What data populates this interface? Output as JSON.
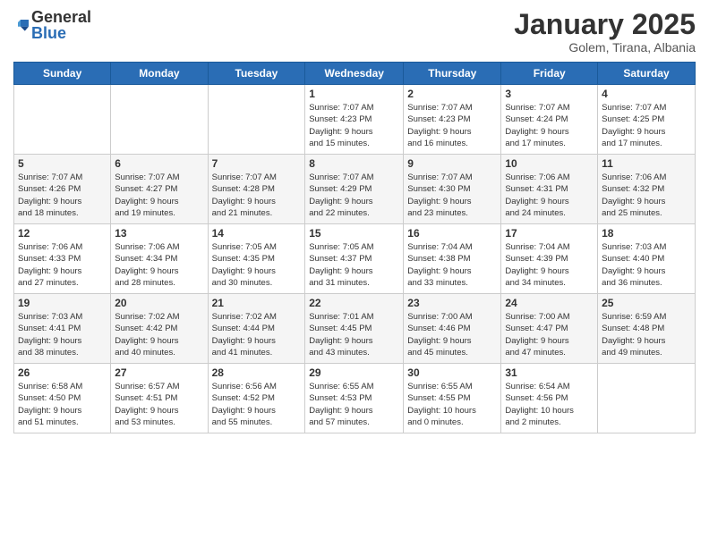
{
  "logo": {
    "general": "General",
    "blue": "Blue"
  },
  "title": "January 2025",
  "location": "Golem, Tirana, Albania",
  "weekdays": [
    "Sunday",
    "Monday",
    "Tuesday",
    "Wednesday",
    "Thursday",
    "Friday",
    "Saturday"
  ],
  "weeks": [
    [
      {
        "day": "",
        "info": ""
      },
      {
        "day": "",
        "info": ""
      },
      {
        "day": "",
        "info": ""
      },
      {
        "day": "1",
        "info": "Sunrise: 7:07 AM\nSunset: 4:23 PM\nDaylight: 9 hours\nand 15 minutes."
      },
      {
        "day": "2",
        "info": "Sunrise: 7:07 AM\nSunset: 4:23 PM\nDaylight: 9 hours\nand 16 minutes."
      },
      {
        "day": "3",
        "info": "Sunrise: 7:07 AM\nSunset: 4:24 PM\nDaylight: 9 hours\nand 17 minutes."
      },
      {
        "day": "4",
        "info": "Sunrise: 7:07 AM\nSunset: 4:25 PM\nDaylight: 9 hours\nand 17 minutes."
      }
    ],
    [
      {
        "day": "5",
        "info": "Sunrise: 7:07 AM\nSunset: 4:26 PM\nDaylight: 9 hours\nand 18 minutes."
      },
      {
        "day": "6",
        "info": "Sunrise: 7:07 AM\nSunset: 4:27 PM\nDaylight: 9 hours\nand 19 minutes."
      },
      {
        "day": "7",
        "info": "Sunrise: 7:07 AM\nSunset: 4:28 PM\nDaylight: 9 hours\nand 21 minutes."
      },
      {
        "day": "8",
        "info": "Sunrise: 7:07 AM\nSunset: 4:29 PM\nDaylight: 9 hours\nand 22 minutes."
      },
      {
        "day": "9",
        "info": "Sunrise: 7:07 AM\nSunset: 4:30 PM\nDaylight: 9 hours\nand 23 minutes."
      },
      {
        "day": "10",
        "info": "Sunrise: 7:06 AM\nSunset: 4:31 PM\nDaylight: 9 hours\nand 24 minutes."
      },
      {
        "day": "11",
        "info": "Sunrise: 7:06 AM\nSunset: 4:32 PM\nDaylight: 9 hours\nand 25 minutes."
      }
    ],
    [
      {
        "day": "12",
        "info": "Sunrise: 7:06 AM\nSunset: 4:33 PM\nDaylight: 9 hours\nand 27 minutes."
      },
      {
        "day": "13",
        "info": "Sunrise: 7:06 AM\nSunset: 4:34 PM\nDaylight: 9 hours\nand 28 minutes."
      },
      {
        "day": "14",
        "info": "Sunrise: 7:05 AM\nSunset: 4:35 PM\nDaylight: 9 hours\nand 30 minutes."
      },
      {
        "day": "15",
        "info": "Sunrise: 7:05 AM\nSunset: 4:37 PM\nDaylight: 9 hours\nand 31 minutes."
      },
      {
        "day": "16",
        "info": "Sunrise: 7:04 AM\nSunset: 4:38 PM\nDaylight: 9 hours\nand 33 minutes."
      },
      {
        "day": "17",
        "info": "Sunrise: 7:04 AM\nSunset: 4:39 PM\nDaylight: 9 hours\nand 34 minutes."
      },
      {
        "day": "18",
        "info": "Sunrise: 7:03 AM\nSunset: 4:40 PM\nDaylight: 9 hours\nand 36 minutes."
      }
    ],
    [
      {
        "day": "19",
        "info": "Sunrise: 7:03 AM\nSunset: 4:41 PM\nDaylight: 9 hours\nand 38 minutes."
      },
      {
        "day": "20",
        "info": "Sunrise: 7:02 AM\nSunset: 4:42 PM\nDaylight: 9 hours\nand 40 minutes."
      },
      {
        "day": "21",
        "info": "Sunrise: 7:02 AM\nSunset: 4:44 PM\nDaylight: 9 hours\nand 41 minutes."
      },
      {
        "day": "22",
        "info": "Sunrise: 7:01 AM\nSunset: 4:45 PM\nDaylight: 9 hours\nand 43 minutes."
      },
      {
        "day": "23",
        "info": "Sunrise: 7:00 AM\nSunset: 4:46 PM\nDaylight: 9 hours\nand 45 minutes."
      },
      {
        "day": "24",
        "info": "Sunrise: 7:00 AM\nSunset: 4:47 PM\nDaylight: 9 hours\nand 47 minutes."
      },
      {
        "day": "25",
        "info": "Sunrise: 6:59 AM\nSunset: 4:48 PM\nDaylight: 9 hours\nand 49 minutes."
      }
    ],
    [
      {
        "day": "26",
        "info": "Sunrise: 6:58 AM\nSunset: 4:50 PM\nDaylight: 9 hours\nand 51 minutes."
      },
      {
        "day": "27",
        "info": "Sunrise: 6:57 AM\nSunset: 4:51 PM\nDaylight: 9 hours\nand 53 minutes."
      },
      {
        "day": "28",
        "info": "Sunrise: 6:56 AM\nSunset: 4:52 PM\nDaylight: 9 hours\nand 55 minutes."
      },
      {
        "day": "29",
        "info": "Sunrise: 6:55 AM\nSunset: 4:53 PM\nDaylight: 9 hours\nand 57 minutes."
      },
      {
        "day": "30",
        "info": "Sunrise: 6:55 AM\nSunset: 4:55 PM\nDaylight: 10 hours\nand 0 minutes."
      },
      {
        "day": "31",
        "info": "Sunrise: 6:54 AM\nSunset: 4:56 PM\nDaylight: 10 hours\nand 2 minutes."
      },
      {
        "day": "",
        "info": ""
      }
    ]
  ]
}
